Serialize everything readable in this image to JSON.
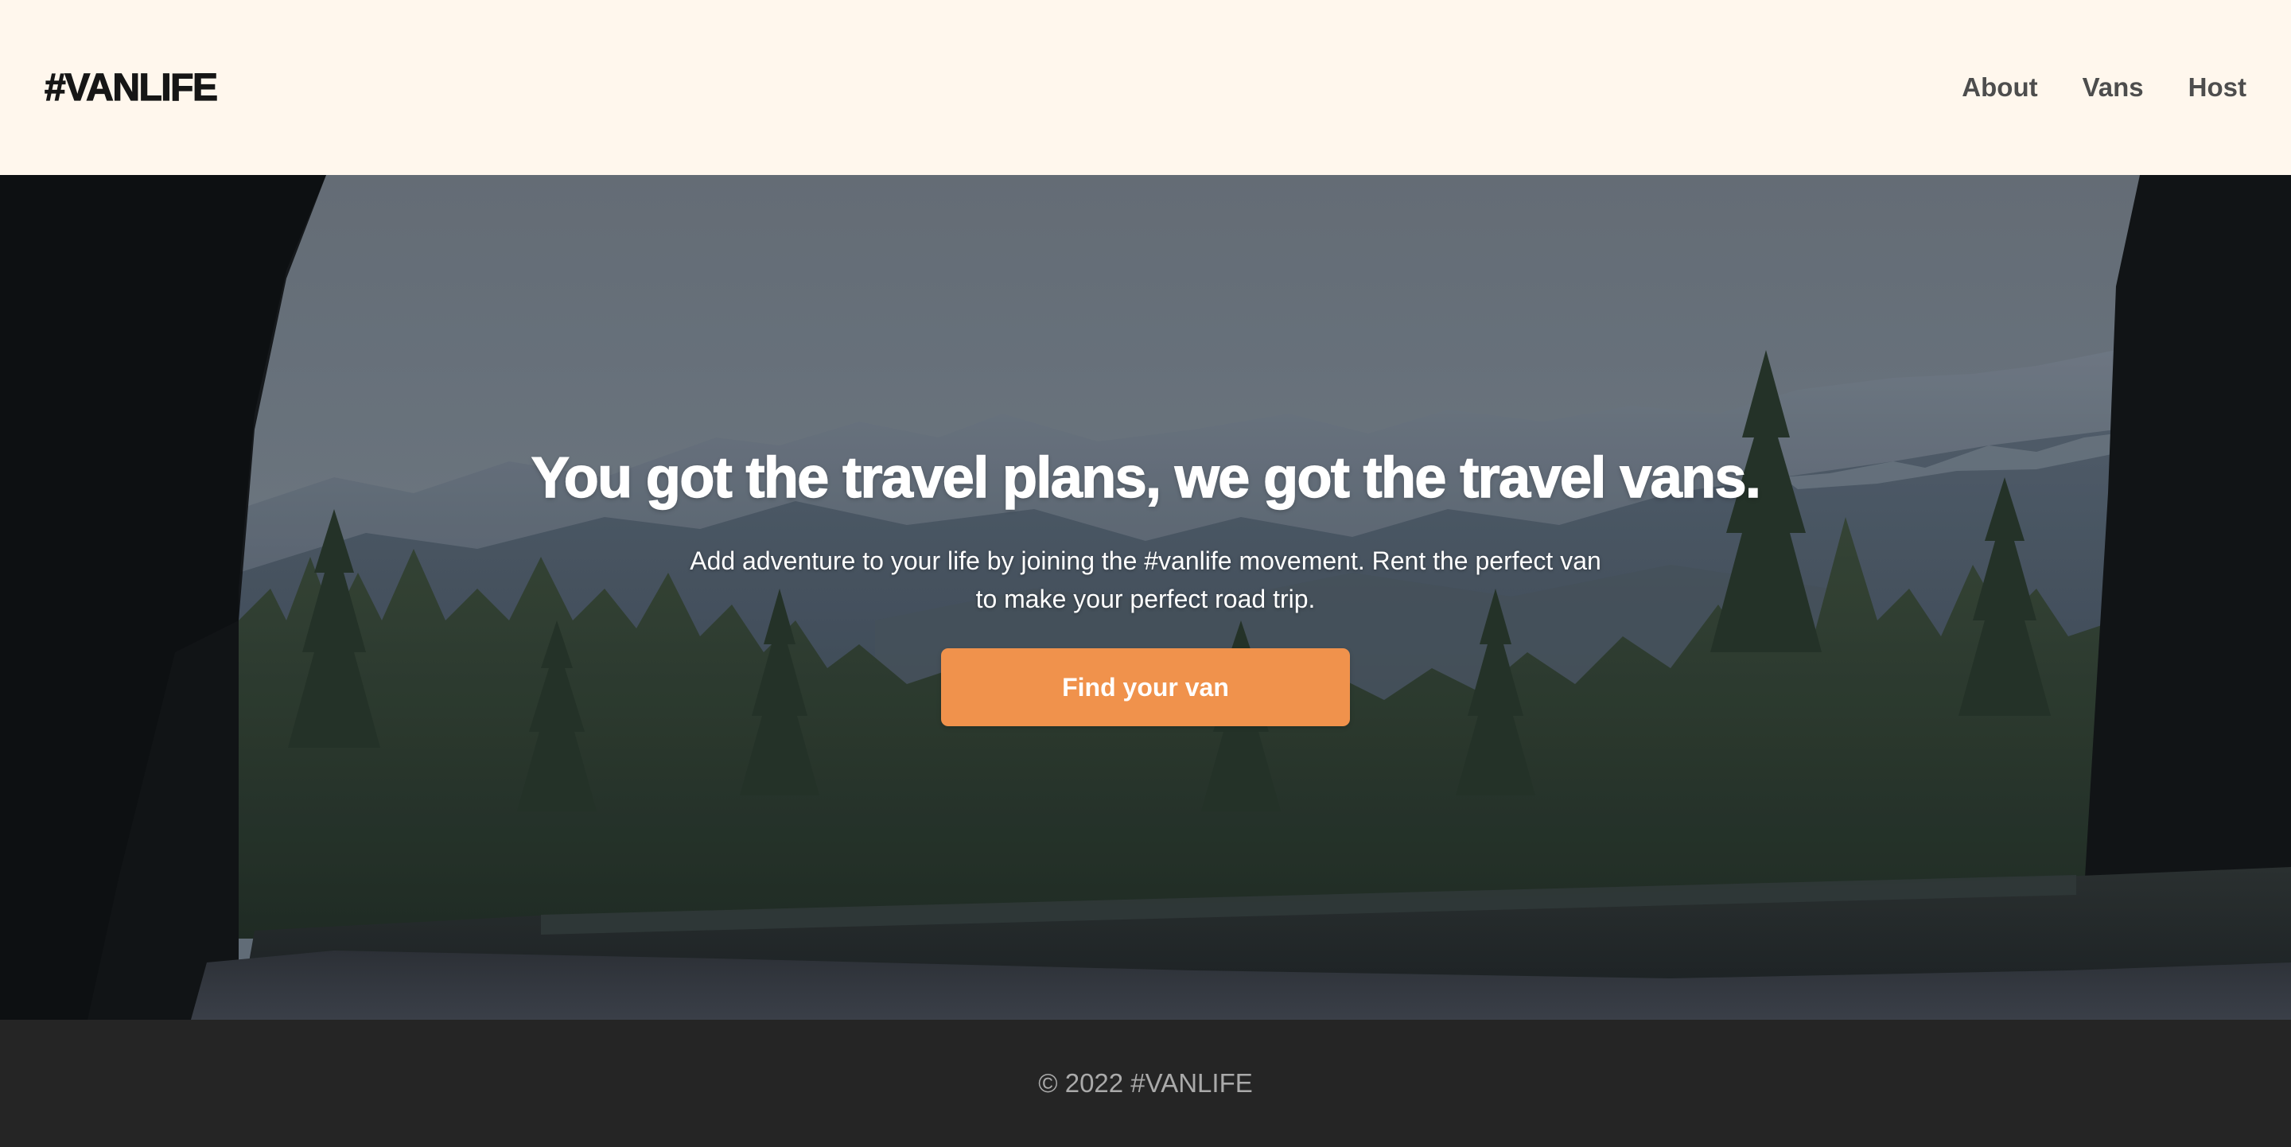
{
  "header": {
    "logo": "#VANLIFE",
    "nav": [
      {
        "label": "About"
      },
      {
        "label": "Vans"
      },
      {
        "label": "Host"
      }
    ]
  },
  "hero": {
    "title": "You got the travel plans, we got the travel vans.",
    "subtitle": "Add adventure to your life by joining the #vanlife movement. Rent the perfect van to make your perfect road trip.",
    "cta_label": "Find your van",
    "background_image": "mountain-forest-through-van-window"
  },
  "footer": {
    "copyright": "© 2022 #VANLIFE"
  },
  "colors": {
    "header_bg": "#FFF7ED",
    "accent": "#F0924C",
    "footer_bg": "#252525",
    "logo": "#161616",
    "nav_link": "#4D4D4D"
  }
}
